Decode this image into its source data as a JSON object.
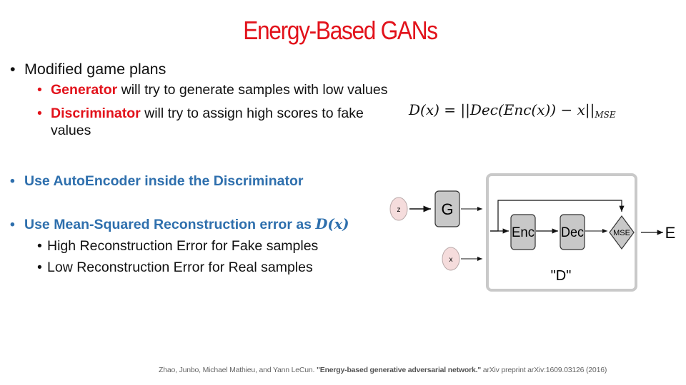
{
  "slide": {
    "title": "Energy-Based GANs",
    "bullets": {
      "modified_game_plans": "Modified game plans",
      "generator_term": "Generator",
      "generator_text": " will try to generate samples with low values",
      "discriminator_term": "Discriminator",
      "discriminator_text": " will try to assign high scores to fake values",
      "autoencoder": "Use AutoEncoder inside the Discriminator",
      "mse_prefix": "Use Mean-Squared Reconstruction error as ",
      "mse_math": "D(x)",
      "high_error": "High Reconstruction Error for Fake samples",
      "low_error": "Low Reconstruction Error for Real samples"
    },
    "formula": {
      "main": "D(x) =  ||Dec(Enc(x)) − x||",
      "subscript": "MSE"
    },
    "diagram": {
      "z_label": "z",
      "x_label": "x",
      "g_label": "G",
      "enc_label": "Enc",
      "dec_label": "Dec",
      "mse_label": "MSE",
      "e_label": "E",
      "d_label": "\"D\"",
      "colors": {
        "input_fill": "#f5dcdc",
        "block_fill": "#c8c8c8",
        "frame": "#c9c9c9"
      }
    },
    "citation": {
      "authors": "Zhao, Junbo, Michael Mathieu, and Yann LeCun. ",
      "paper_title": "\"Energy-based generative adversarial network.\"",
      "venue": " arXiv preprint arXiv:1609.03126 (2016)"
    },
    "colors": {
      "title": "#e2121b",
      "emphasis_red": "#e2121b",
      "emphasis_blue": "#2e6fad"
    }
  }
}
